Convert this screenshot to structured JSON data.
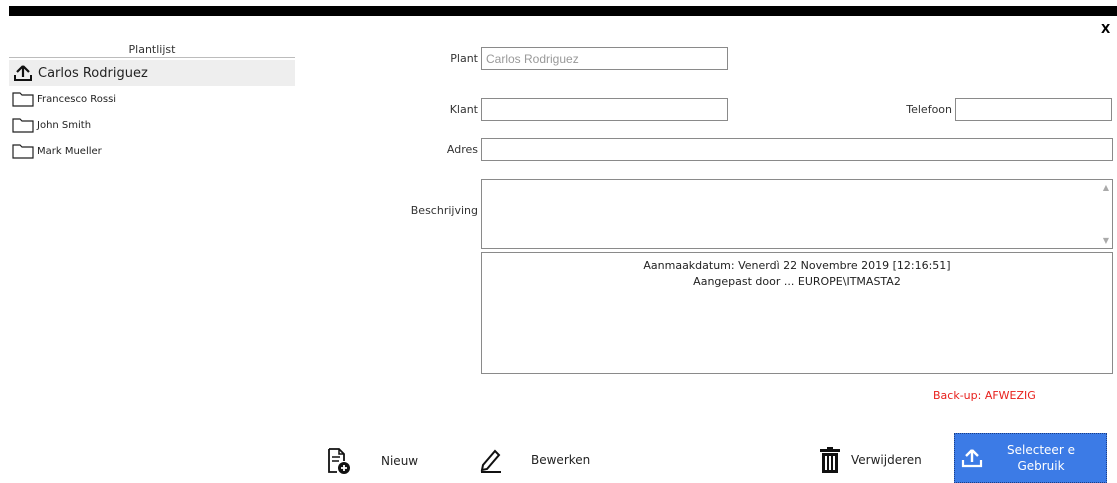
{
  "window": {
    "close_label": "X"
  },
  "sidebar": {
    "title": "Plantlijst",
    "items": [
      {
        "label": "Carlos Rodriguez",
        "icon": "upload-icon",
        "selected": true
      },
      {
        "label": "Francesco Rossi",
        "icon": "folder-icon",
        "selected": false
      },
      {
        "label": "John Smith",
        "icon": "folder-icon",
        "selected": false
      },
      {
        "label": "Mark Mueller",
        "icon": "folder-icon",
        "selected": false
      }
    ]
  },
  "form": {
    "plant_label": "Plant",
    "plant_value": "Carlos Rodriguez",
    "klant_label": "Klant",
    "klant_value": "",
    "telefoon_label": "Telefoon",
    "telefoon_value": "",
    "adres_label": "Adres",
    "adres_value": "",
    "beschrijving_label": "Beschrijving",
    "beschrijving_value": ""
  },
  "info": {
    "created": "Aanmaakdatum: Venerdì 22 Novembre 2019 [12:16:51]",
    "modified": "Aangepast door ... EUROPE\\ITMASTA2"
  },
  "backup_status": "Back-up: AFWEZIG",
  "toolbar": {
    "new_label": "Nieuw",
    "edit_label": "Bewerken",
    "delete_label": "Verwijderen",
    "select_label_line1": "Selecteer e",
    "select_label_line2": "Gebruik"
  },
  "colors": {
    "accent": "#3c7be6",
    "warning": "#e8201c",
    "topbar": "#000000"
  }
}
